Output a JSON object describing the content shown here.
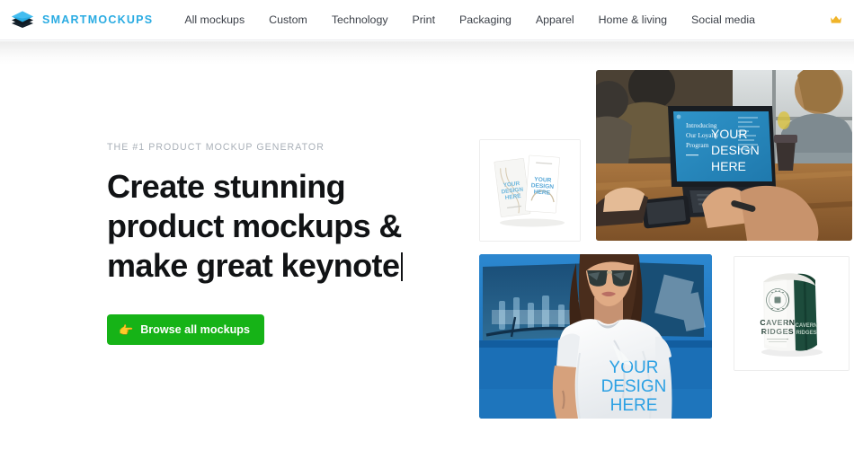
{
  "header": {
    "brand_name": "SMARTMOCKUPS",
    "logo_icon": "stacked-layers-icon",
    "logo_color_top": "#29abe2",
    "logo_color_bottom": "#16232e",
    "brand_color": "#29abe2",
    "nav_items": [
      {
        "label": "All mockups"
      },
      {
        "label": "Custom"
      },
      {
        "label": "Technology"
      },
      {
        "label": "Print"
      },
      {
        "label": "Packaging"
      },
      {
        "label": "Apparel"
      },
      {
        "label": "Home & living"
      },
      {
        "label": "Social media"
      }
    ],
    "crown_icon": "crown-icon",
    "crown_color": "#f0b429"
  },
  "hero": {
    "eyebrow": "THE #1 PRODUCT MOCKUP GENERATOR",
    "headline_line1": "Create stunning",
    "headline_line2": "product mockups &",
    "headline_line3": "make great keynote",
    "typing_caret": true,
    "cta": {
      "emoji": "👉",
      "label": "Browse all mockups",
      "color": "#16b317",
      "text_color": "#ffffff"
    }
  },
  "gallery": {
    "tiles": [
      {
        "name": "business-cards-mockup",
        "kind": "product-card",
        "overlay_text": "YOUR DESIGN HERE",
        "overlay_color": "#4aa8dd",
        "background": "#ffffff"
      },
      {
        "name": "laptop-meeting-mockup",
        "kind": "photo",
        "screen_heading": "Introducing Our Loyalty Program",
        "overlay_text": "YOUR DESIGN HERE",
        "overlay_color": "#ffffff",
        "screen_color": "#2a8fc4"
      },
      {
        "name": "tshirt-woman-van-mockup",
        "kind": "photo",
        "overlay_text": "YOUR DESIGN HERE",
        "overlay_color": "#2a9fe0",
        "background": "#1e7fd4"
      },
      {
        "name": "coffee-bag-mockup",
        "kind": "product-card",
        "brand_line1": "CAVERN",
        "brand_line2": "RIDGES",
        "bag_color": "#1d4c3c",
        "background": "#ffffff"
      }
    ]
  }
}
